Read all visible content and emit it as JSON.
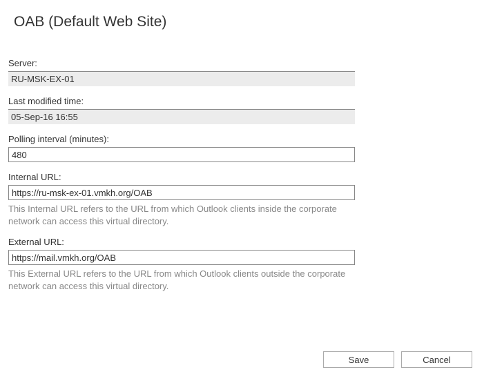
{
  "title": "OAB (Default Web Site)",
  "fields": {
    "server": {
      "label": "Server:",
      "value": "RU-MSK-EX-01"
    },
    "lastModified": {
      "label": "Last modified time:",
      "value": "05-Sep-16 16:55"
    },
    "pollingInterval": {
      "label": "Polling interval (minutes):",
      "value": "480"
    },
    "internalUrl": {
      "label": "Internal URL:",
      "value": "https://ru-msk-ex-01.vmkh.org/OAB",
      "help": "This Internal URL refers to the URL from which Outlook clients inside the corporate network can access this virtual directory."
    },
    "externalUrl": {
      "label": "External URL:",
      "value": "https://mail.vmkh.org/OAB",
      "help": "This External URL refers to the URL from which Outlook clients outside the corporate network can access this virtual directory."
    }
  },
  "buttons": {
    "save": "Save",
    "cancel": "Cancel"
  }
}
